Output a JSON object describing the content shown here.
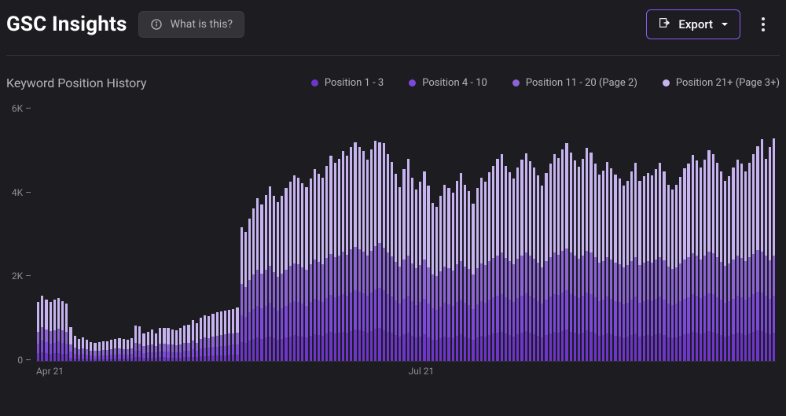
{
  "header": {
    "title": "GSC Insights",
    "info_label": "What is this?",
    "export_label": "Export"
  },
  "chart_data": {
    "type": "bar",
    "title": "Keyword Position History",
    "ylabel": "",
    "ylim": [
      0,
      6000
    ],
    "y_ticks": [
      {
        "value": 6000,
        "label": "6K"
      },
      {
        "value": 4000,
        "label": "4K"
      },
      {
        "value": 2000,
        "label": "2K"
      },
      {
        "value": 0,
        "label": "0"
      }
    ],
    "x_ticks": [
      {
        "index": 0,
        "label": "Apr 21"
      },
      {
        "index": 91,
        "label": "Jul 21"
      }
    ],
    "series": [
      {
        "name": "Position 1 - 3",
        "color": "#6d35c9"
      },
      {
        "name": "Position 4 - 10",
        "color": "#7d49da"
      },
      {
        "name": "Position 11 - 20 (Page 2)",
        "color": "#8d64d5"
      },
      {
        "name": "Position 21+ (Page 3+)",
        "color": "#c6b3ef"
      }
    ],
    "stacks": [
      [
        180,
        240,
        280,
        700
      ],
      [
        200,
        280,
        320,
        750
      ],
      [
        190,
        260,
        300,
        720
      ],
      [
        170,
        250,
        290,
        690
      ],
      [
        180,
        260,
        300,
        720
      ],
      [
        190,
        270,
        310,
        740
      ],
      [
        175,
        255,
        295,
        710
      ],
      [
        165,
        245,
        285,
        680
      ],
      [
        80,
        140,
        180,
        400
      ],
      [
        60,
        110,
        150,
        280
      ],
      [
        50,
        100,
        140,
        240
      ],
      [
        55,
        105,
        145,
        250
      ],
      [
        50,
        95,
        135,
        230
      ],
      [
        40,
        85,
        125,
        200
      ],
      [
        35,
        80,
        120,
        190
      ],
      [
        40,
        85,
        125,
        200
      ],
      [
        45,
        90,
        130,
        200
      ],
      [
        42,
        88,
        128,
        205
      ],
      [
        48,
        95,
        135,
        220
      ],
      [
        52,
        100,
        140,
        230
      ],
      [
        55,
        105,
        145,
        240
      ],
      [
        50,
        100,
        140,
        230
      ],
      [
        48,
        96,
        136,
        225
      ],
      [
        55,
        105,
        145,
        240
      ],
      [
        95,
        150,
        190,
        400
      ],
      [
        90,
        145,
        185,
        400
      ],
      [
        70,
        125,
        165,
        300
      ],
      [
        75,
        130,
        170,
        320
      ],
      [
        80,
        135,
        175,
        360
      ],
      [
        72,
        126,
        166,
        300
      ],
      [
        85,
        140,
        180,
        390
      ],
      [
        88,
        144,
        184,
        380
      ],
      [
        82,
        138,
        178,
        390
      ],
      [
        78,
        134,
        174,
        360
      ],
      [
        75,
        130,
        170,
        350
      ],
      [
        80,
        135,
        175,
        400
      ],
      [
        95,
        148,
        188,
        420
      ],
      [
        88,
        150,
        190,
        440
      ],
      [
        100,
        175,
        220,
        480
      ],
      [
        90,
        155,
        195,
        460
      ],
      [
        110,
        190,
        230,
        500
      ],
      [
        120,
        200,
        245,
        530
      ],
      [
        115,
        195,
        240,
        520
      ],
      [
        125,
        210,
        255,
        540
      ],
      [
        130,
        215,
        260,
        550
      ],
      [
        135,
        220,
        265,
        560
      ],
      [
        140,
        225,
        270,
        570
      ],
      [
        145,
        230,
        275,
        575
      ],
      [
        150,
        235,
        280,
        580
      ],
      [
        155,
        240,
        285,
        590
      ],
      [
        450,
        640,
        740,
        1350
      ],
      [
        430,
        620,
        720,
        1310
      ],
      [
        480,
        680,
        780,
        1460
      ],
      [
        520,
        720,
        820,
        1570
      ],
      [
        560,
        760,
        860,
        1700
      ],
      [
        530,
        730,
        830,
        1650
      ],
      [
        560,
        760,
        860,
        1770
      ],
      [
        590,
        790,
        890,
        1900
      ],
      [
        540,
        740,
        840,
        1820
      ],
      [
        500,
        700,
        800,
        1780
      ],
      [
        530,
        730,
        830,
        1850
      ],
      [
        560,
        760,
        860,
        1950
      ],
      [
        590,
        790,
        890,
        2000
      ],
      [
        610,
        810,
        910,
        2100
      ],
      [
        600,
        800,
        900,
        2070
      ],
      [
        580,
        780,
        880,
        2000
      ],
      [
        560,
        760,
        860,
        1960
      ],
      [
        600,
        800,
        900,
        2050
      ],
      [
        640,
        840,
        940,
        2150
      ],
      [
        620,
        820,
        920,
        2100
      ],
      [
        600,
        800,
        900,
        2060
      ],
      [
        650,
        850,
        950,
        2200
      ],
      [
        690,
        880,
        980,
        2350
      ],
      [
        660,
        860,
        960,
        2250
      ],
      [
        680,
        870,
        970,
        2300
      ],
      [
        700,
        900,
        1000,
        2400
      ],
      [
        680,
        880,
        980,
        2350
      ],
      [
        720,
        920,
        1020,
        2450
      ],
      [
        750,
        930,
        1030,
        2500
      ],
      [
        730,
        920,
        1010,
        2450
      ],
      [
        710,
        900,
        990,
        2400
      ],
      [
        680,
        870,
        960,
        2300
      ],
      [
        720,
        910,
        1000,
        2420
      ],
      [
        760,
        940,
        1040,
        2520
      ],
      [
        790,
        960,
        1070,
        2400
      ],
      [
        740,
        940,
        1020,
        2500
      ],
      [
        700,
        900,
        980,
        2350
      ],
      [
        670,
        870,
        960,
        2250
      ],
      [
        620,
        830,
        910,
        2100
      ],
      [
        580,
        790,
        880,
        1900
      ],
      [
        640,
        850,
        930,
        2150
      ],
      [
        680,
        880,
        960,
        2300
      ],
      [
        600,
        820,
        900,
        2050
      ],
      [
        560,
        780,
        870,
        1880
      ],
      [
        590,
        810,
        890,
        1980
      ],
      [
        630,
        850,
        930,
        2100
      ],
      [
        570,
        790,
        880,
        1950
      ],
      [
        510,
        740,
        820,
        1700
      ],
      [
        500,
        720,
        800,
        1660
      ],
      [
        540,
        760,
        840,
        1800
      ],
      [
        580,
        800,
        880,
        1950
      ],
      [
        560,
        790,
        870,
        1900
      ],
      [
        540,
        770,
        850,
        1850
      ],
      [
        600,
        810,
        890,
        2000
      ],
      [
        630,
        840,
        920,
        2100
      ],
      [
        580,
        800,
        880,
        1950
      ],
      [
        550,
        780,
        860,
        1870
      ],
      [
        500,
        740,
        820,
        1700
      ],
      [
        560,
        790,
        870,
        1900
      ],
      [
        600,
        820,
        900,
        2050
      ],
      [
        580,
        810,
        890,
        2000
      ],
      [
        620,
        840,
        920,
        2120
      ],
      [
        650,
        860,
        940,
        2200
      ],
      [
        680,
        880,
        960,
        2300
      ],
      [
        700,
        900,
        980,
        2350
      ],
      [
        650,
        860,
        940,
        2200
      ],
      [
        620,
        840,
        920,
        2120
      ],
      [
        590,
        820,
        900,
        2050
      ],
      [
        640,
        860,
        940,
        2180
      ],
      [
        680,
        880,
        960,
        2280
      ],
      [
        710,
        900,
        980,
        2360
      ],
      [
        670,
        880,
        960,
        2260
      ],
      [
        640,
        860,
        940,
        2180
      ],
      [
        600,
        830,
        910,
        2080
      ],
      [
        560,
        800,
        880,
        1950
      ],
      [
        620,
        840,
        920,
        2100
      ],
      [
        660,
        870,
        950,
        2220
      ],
      [
        700,
        900,
        980,
        2350
      ],
      [
        680,
        890,
        970,
        2300
      ],
      [
        720,
        910,
        990,
        2420
      ],
      [
        750,
        930,
        1010,
        2500
      ],
      [
        700,
        900,
        980,
        2380
      ],
      [
        670,
        880,
        960,
        2280
      ],
      [
        640,
        860,
        940,
        2190
      ],
      [
        680,
        880,
        960,
        2300
      ],
      [
        730,
        910,
        990,
        2450
      ],
      [
        700,
        900,
        980,
        2380
      ],
      [
        650,
        870,
        950,
        2230
      ],
      [
        600,
        830,
        910,
        2100
      ],
      [
        620,
        840,
        920,
        2150
      ],
      [
        660,
        870,
        950,
        2260
      ],
      [
        630,
        850,
        930,
        2180
      ],
      [
        600,
        830,
        910,
        2100
      ],
      [
        580,
        820,
        900,
        2050
      ],
      [
        550,
        800,
        880,
        1950
      ],
      [
        580,
        810,
        890,
        2020
      ],
      [
        620,
        840,
        920,
        2140
      ],
      [
        660,
        870,
        950,
        2250
      ],
      [
        580,
        810,
        890,
        2020
      ],
      [
        600,
        832,
        912,
        2070
      ],
      [
        620,
        842,
        922,
        2100
      ],
      [
        600,
        836,
        916,
        2080
      ],
      [
        630,
        850,
        930,
        2160
      ],
      [
        660,
        870,
        950,
        2250
      ],
      [
        620,
        846,
        926,
        2120
      ],
      [
        560,
        804,
        884,
        1960
      ],
      [
        540,
        788,
        868,
        1900
      ],
      [
        560,
        800,
        880,
        1960
      ],
      [
        600,
        820,
        900,
        2060
      ],
      [
        640,
        850,
        930,
        2180
      ],
      [
        660,
        866,
        946,
        2240
      ],
      [
        700,
        892,
        972,
        2350
      ],
      [
        670,
        878,
        958,
        2280
      ],
      [
        640,
        852,
        932,
        2180
      ],
      [
        680,
        872,
        952,
        2300
      ],
      [
        720,
        902,
        982,
        2420
      ],
      [
        700,
        896,
        976,
        2360
      ],
      [
        660,
        866,
        946,
        2250
      ],
      [
        620,
        836,
        916,
        2140
      ],
      [
        580,
        808,
        888,
        2020
      ],
      [
        600,
        820,
        900,
        2080
      ],
      [
        640,
        848,
        928,
        2200
      ],
      [
        680,
        872,
        952,
        2300
      ],
      [
        660,
        862,
        942,
        2250
      ],
      [
        620,
        838,
        918,
        2150
      ],
      [
        660,
        864,
        944,
        2260
      ],
      [
        700,
        890,
        970,
        2370
      ],
      [
        740,
        916,
        996,
        2476
      ],
      [
        720,
        906,
        986,
        2676
      ],
      [
        680,
        878,
        958,
        2306
      ],
      [
        630,
        846,
        926,
        2700
      ],
      [
        680,
        878,
        950,
        2800
      ]
    ]
  }
}
